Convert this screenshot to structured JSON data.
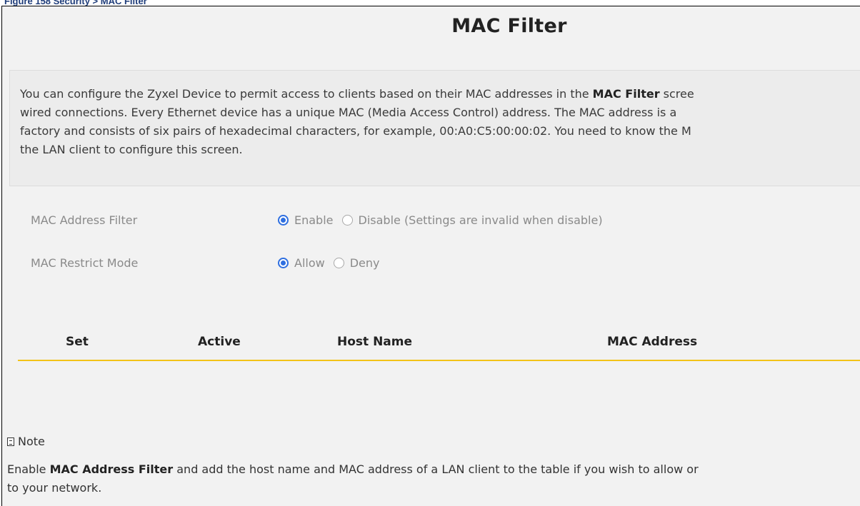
{
  "caption": "Figure 158   Security > MAC Filter",
  "title": "MAC Filter",
  "description": {
    "line1_pre": "You can configure the Zyxel Device to permit access to clients based on their MAC addresses in the ",
    "line1_bold": "MAC Filter",
    "line1_post": " scree",
    "line2": "wired connections. Every Ethernet device has a unique MAC (Media Access Control) address. The MAC address is a",
    "line3": "factory and consists of six pairs of hexadecimal characters, for example, 00:A0:C5:00:00:02. You need to know the M",
    "line4": "the LAN client to configure this screen."
  },
  "mac_filter": {
    "label": "MAC Address Filter",
    "option_enable": "Enable",
    "option_disable": "Disable (Settings are invalid when disable)",
    "selected": "Enable"
  },
  "restrict_mode": {
    "label": "MAC Restrict Mode",
    "option_allow": "Allow",
    "option_deny": "Deny",
    "selected": "Allow"
  },
  "table": {
    "headers": [
      "Set",
      "Active",
      "Host Name",
      "MAC Address"
    ],
    "rows": []
  },
  "note": {
    "heading": "Note",
    "icon": "document-icon",
    "line1_pre": "Enable ",
    "line1_bold": "MAC Address Filter",
    "line1_post": " and add the host name and MAC address of a LAN client to the table if you wish to allow or",
    "line2": "to your network."
  },
  "colors": {
    "accent_radio": "#2f6fe0",
    "table_rule": "#f3c318",
    "panel_bg": "#f2f2f2"
  }
}
